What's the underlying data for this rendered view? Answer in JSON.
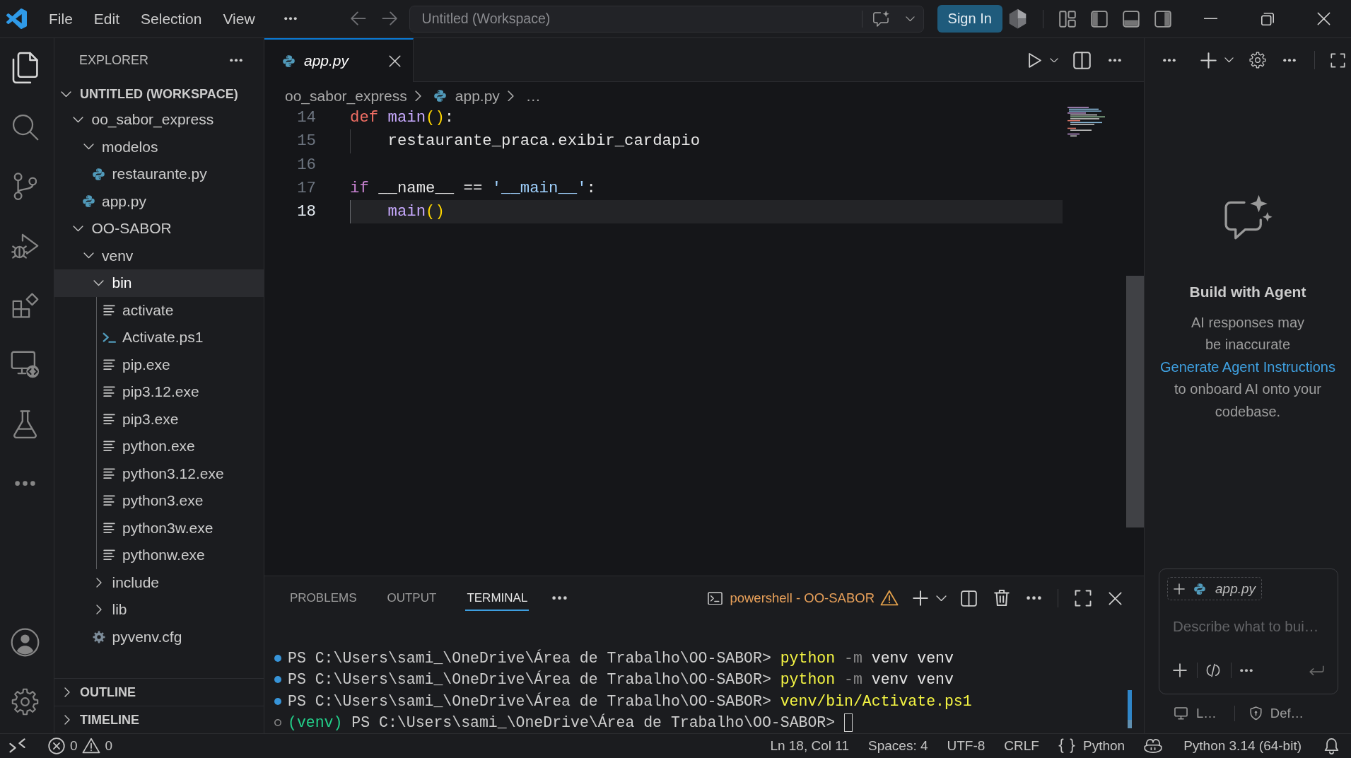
{
  "title_bar": {
    "menus": [
      "File",
      "Edit",
      "Selection",
      "View"
    ],
    "command_center": "Untitled (Workspace)",
    "sign_in": "Sign In",
    "layout_toggles": [
      {
        "on": true
      },
      {
        "on": true
      },
      {
        "on": true
      }
    ]
  },
  "activity_bar": {
    "items": [
      {
        "selected": true
      },
      {
        "selected": false
      },
      {
        "selected": false
      },
      {
        "selected": false
      },
      {
        "selected": false
      },
      {
        "selected": false
      },
      {
        "selected": false
      }
    ]
  },
  "sidebar": {
    "title": "EXPLORER",
    "sections": [
      {
        "title": "UNTITLED (WORKSPACE)",
        "expanded": true,
        "tree": [
          {
            "label": "oo_sabor_express",
            "kind": "folder",
            "expanded": true,
            "selected": false,
            "children": [
              {
                "label": "modelos",
                "kind": "folder",
                "expanded": true,
                "selected": false,
                "children": [
                  {
                    "label": "restaurante.py",
                    "kind": "python",
                    "selected": false
                  }
                ]
              },
              {
                "label": "app.py",
                "kind": "python",
                "selected": false
              }
            ]
          },
          {
            "label": "OO-SABOR",
            "kind": "folder",
            "expanded": true,
            "selected": false,
            "children": [
              {
                "label": "venv",
                "kind": "folder",
                "expanded": true,
                "selected": false,
                "children": [
                  {
                    "label": "bin",
                    "kind": "folder",
                    "expanded": true,
                    "selected": true,
                    "children": [
                      {
                        "label": "activate",
                        "kind": "text",
                        "selected": false
                      },
                      {
                        "label": "Activate.ps1",
                        "kind": "powershell",
                        "selected": false
                      },
                      {
                        "label": "pip.exe",
                        "kind": "text",
                        "selected": false
                      },
                      {
                        "label": "pip3.12.exe",
                        "kind": "text",
                        "selected": false
                      },
                      {
                        "label": "pip3.exe",
                        "kind": "text",
                        "selected": false
                      },
                      {
                        "label": "python.exe",
                        "kind": "text",
                        "selected": false
                      },
                      {
                        "label": "python3.12.exe",
                        "kind": "text",
                        "selected": false
                      },
                      {
                        "label": "python3.exe",
                        "kind": "text",
                        "selected": false
                      },
                      {
                        "label": "python3w.exe",
                        "kind": "text",
                        "selected": false
                      },
                      {
                        "label": "pythonw.exe",
                        "kind": "text",
                        "selected": false
                      }
                    ]
                  },
                  {
                    "label": "include",
                    "kind": "folder",
                    "expanded": false,
                    "selected": false
                  },
                  {
                    "label": "lib",
                    "kind": "folder",
                    "expanded": false,
                    "selected": false
                  },
                  {
                    "label": "pyvenv.cfg",
                    "kind": "config",
                    "selected": false
                  }
                ]
              }
            ]
          }
        ]
      },
      {
        "title": "OUTLINE",
        "expanded": false
      },
      {
        "title": "TIMELINE",
        "expanded": false
      }
    ]
  },
  "editor": {
    "tabs": [
      {
        "label": "app.py",
        "selected": true,
        "preview": true
      }
    ],
    "breadcrumbs": [
      {
        "label": "oo_sabor_express",
        "kind": "folder"
      },
      {
        "label": "app.py",
        "kind": "python"
      },
      {
        "label": "…",
        "kind": "symbol"
      }
    ],
    "lines": [
      {
        "number": "14",
        "current": false,
        "tokens": [
          {
            "kind": "keyword",
            "text": "def "
          },
          {
            "kind": "function",
            "text": "main"
          },
          {
            "kind": "bracket",
            "text": "()"
          },
          {
            "kind": "plain",
            "text": ":"
          }
        ]
      },
      {
        "number": "15",
        "current": false,
        "tokens": [
          {
            "kind": "indent"
          },
          {
            "kind": "plain",
            "text": "restaurante_praca.exibir_cardapio"
          }
        ]
      },
      {
        "number": "16",
        "current": false
      },
      {
        "number": "17",
        "current": false,
        "tokens": [
          {
            "kind": "control",
            "text": "if"
          },
          {
            "kind": "plain",
            "text": " __name__ == "
          },
          {
            "kind": "string",
            "text": "'__main__'"
          },
          {
            "kind": "plain",
            "text": ":"
          }
        ]
      },
      {
        "number": "18",
        "current": true,
        "tokens": [
          {
            "kind": "indent"
          },
          {
            "kind": "function",
            "text": "main"
          },
          {
            "kind": "bracket",
            "text": "()"
          }
        ]
      }
    ]
  },
  "panel": {
    "tabs": [
      {
        "label": "PROBLEMS",
        "selected": false
      },
      {
        "label": "OUTPUT",
        "selected": false
      },
      {
        "label": "TERMINAL",
        "selected": true
      }
    ],
    "terminal_name": "powershell - OO-SABOR",
    "lines": [
      {
        "completed": true,
        "cursor": false,
        "segments": [
          {
            "kind": "prompt",
            "text": "PS C:\\Users\\sami_\\OneDrive\\Área de Trabalho\\OO-SABOR>"
          },
          {
            "kind": "command",
            "text": "python"
          },
          {
            "kind": "flag",
            "text": "-m"
          },
          {
            "kind": "argument",
            "text": "venv venv"
          }
        ]
      },
      {
        "completed": true,
        "cursor": false,
        "segments": [
          {
            "kind": "prompt",
            "text": "PS C:\\Users\\sami_\\OneDrive\\Área de Trabalho\\OO-SABOR>"
          },
          {
            "kind": "command",
            "text": "python"
          },
          {
            "kind": "flag",
            "text": "-m"
          },
          {
            "kind": "argument",
            "text": "venv venv"
          }
        ]
      },
      {
        "completed": true,
        "cursor": false,
        "segments": [
          {
            "kind": "prompt",
            "text": "PS C:\\Users\\sami_\\OneDrive\\Área de Trabalho\\OO-SABOR>"
          },
          {
            "kind": "command",
            "text": "venv/bin/Activate.ps1"
          }
        ]
      },
      {
        "completed": false,
        "cursor": true,
        "segments": [
          {
            "kind": "env",
            "text": "(venv)"
          },
          {
            "kind": "prompt",
            "text": "PS C:\\Users\\sami_\\OneDrive\\Área de Trabalho\\OO-SABOR>"
          }
        ]
      }
    ]
  },
  "chat": {
    "title": "Build with Agent",
    "disclaimer": "AI responses may be inaccurate",
    "hint": {
      "link": "Generate Agent Instructions",
      "text": "to onboard AI onto your codebase."
    },
    "context": "app.py",
    "input": {
      "placeholder": "Describe what to bui…"
    },
    "footer": [
      "L…",
      "Def…"
    ]
  },
  "status_bar": {
    "errors": "0",
    "warnings": "0",
    "items": [
      "Ln 18, Col 11",
      "Spaces: 4",
      "UTF-8",
      "CRLF"
    ],
    "language": "Python",
    "interpreter": "Python 3.14 (64-bit)"
  }
}
